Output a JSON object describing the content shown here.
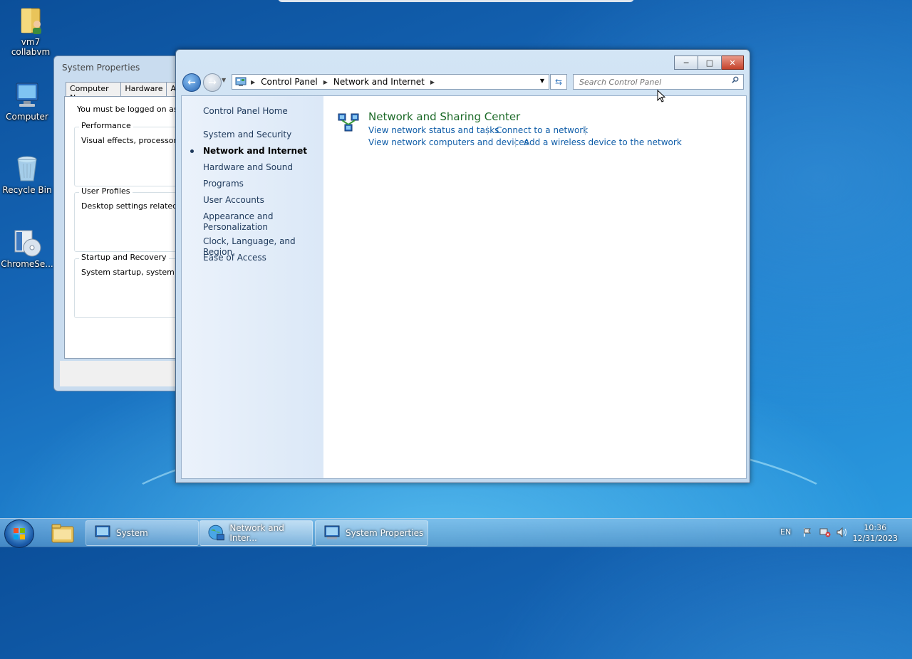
{
  "desktop": {
    "icons": [
      {
        "label": "vm7\ncollabvm",
        "icon": "user-folder-icon"
      },
      {
        "label": "Computer",
        "icon": "computer-icon"
      },
      {
        "label": "Recycle Bin",
        "icon": "recycle-bin-icon"
      },
      {
        "label": "ChromeSe...",
        "icon": "setup-disc-icon"
      }
    ],
    "vm7": "vm7",
    "collabvm": "collabvm",
    "computer": "Computer",
    "recycle_bin": "Recycle Bin",
    "chrome": "ChromeSe..."
  },
  "system_properties": {
    "title": "System Properties",
    "tabs": [
      "Computer Name",
      "Hardware",
      "A"
    ],
    "message": "You must be logged on as an",
    "groups": [
      {
        "title": "Performance",
        "desc": "Visual effects, processor sch"
      },
      {
        "title": "User Profiles",
        "desc": "Desktop settings related to y"
      },
      {
        "title": "Startup and Recovery",
        "desc": "System startup, system failur"
      }
    ]
  },
  "control_panel": {
    "breadcrumb": [
      "Control Panel",
      "Network and Internet"
    ],
    "search_placeholder": "Search Control Panel",
    "left_nav": {
      "home": "Control Panel Home",
      "items": [
        "System and Security",
        "Network and Internet",
        "Hardware and Sound",
        "Programs",
        "User Accounts",
        "Appearance and",
        "Personalization",
        "Clock, Language, and Region",
        "Ease of Access"
      ],
      "active": "Network and Internet"
    },
    "category": {
      "title": "Network and Sharing Center",
      "links": [
        "View network status and tasks",
        "Connect to a network",
        "View network computers and devices",
        "Add a wireless device to the network"
      ]
    }
  },
  "taskbar": {
    "buttons": [
      "System",
      "Network and Inter...",
      "System Properties"
    ],
    "language": "EN",
    "time": "10:36",
    "date": "12/31/2023"
  },
  "colors": {
    "link": "#0f5da8",
    "category_title": "#1c6a28",
    "nav_text": "#1e395b"
  }
}
